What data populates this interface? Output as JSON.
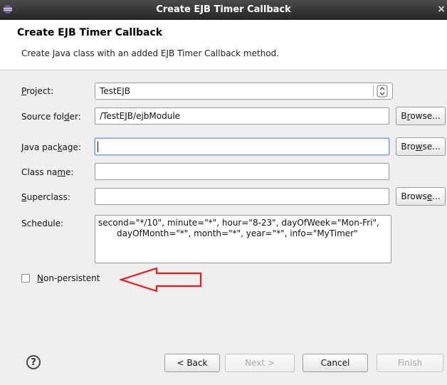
{
  "window": {
    "title": "Create EJB Timer Callback",
    "close_glyph": "×"
  },
  "header": {
    "title": "Create EJB Timer Callback",
    "description": "Create Java class with an added EJB Timer Callback method."
  },
  "form": {
    "project": {
      "label_pre": "",
      "label_mn": "P",
      "label_post": "roject:",
      "value": "TestEJB"
    },
    "source_folder": {
      "label_pre": "Source fol",
      "label_mn": "d",
      "label_post": "er:",
      "value": "/TestEJB/ejbModule"
    },
    "java_package": {
      "label_pre": "Java pac",
      "label_mn": "k",
      "label_post": "age:",
      "value": ""
    },
    "class_name": {
      "label_pre": "Class na",
      "label_mn": "m",
      "label_post": "e:",
      "value": ""
    },
    "superclass": {
      "label_pre": "",
      "label_mn": "S",
      "label_post": "uperclass:",
      "value": ""
    },
    "schedule": {
      "label": "Schedule:",
      "line1": "second=\"*/10\", minute=\"*\", hour=\"8-23\", dayOfWeek=\"Mon-Fri\",",
      "line2": "dayOfMonth=\"*\", month=\"*\", year=\"*\", info=\"MyTimer\""
    },
    "non_persistent": {
      "label_mn": "N",
      "label_post": "on-persistent",
      "checked": false
    }
  },
  "browse_buttons": {
    "source": {
      "pre": "B",
      "mn": "r",
      "post": "owse..."
    },
    "package": {
      "pre": "Bro",
      "mn": "w",
      "post": "se..."
    },
    "superclass": {
      "pre": "Brows",
      "mn": "e",
      "post": "..."
    }
  },
  "footer": {
    "help": "?",
    "back": "< Back",
    "next": "Next >",
    "cancel": "Cancel",
    "finish": "Finish"
  },
  "annotation": {
    "color": "#e81c1c",
    "shape": "left-pointing-arrow-outline"
  }
}
